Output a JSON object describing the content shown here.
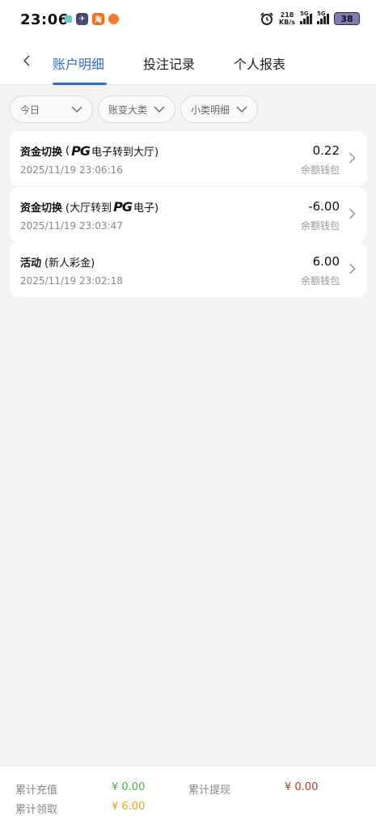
{
  "status_bar": {
    "time": "23:06",
    "net_speed_value": "218",
    "net_speed_unit": "KB/s",
    "sim1": "5G",
    "sim2": "5G",
    "battery": "38"
  },
  "nav": {
    "tabs": [
      {
        "label": "账户明细",
        "active": true
      },
      {
        "label": "投注记录",
        "active": false
      },
      {
        "label": "个人报表",
        "active": false
      }
    ]
  },
  "filters": [
    {
      "label": "今日"
    },
    {
      "label": "账变大类"
    },
    {
      "label": "小类明细"
    }
  ],
  "records": [
    {
      "type": "资金切换",
      "detail_prefix": "(",
      "logo": "PG",
      "detail_suffix": "电子转到大厅)",
      "time": "2025/11/19 23:06:16",
      "amount": "0.22",
      "wallet": "余额钱包"
    },
    {
      "type": "资金切换",
      "detail_prefix": "(大厅转到",
      "logo": "PG",
      "detail_suffix": "电子)",
      "time": "2025/11/19 23:03:47",
      "amount": "-6.00",
      "wallet": "余额钱包"
    },
    {
      "type": "活动",
      "detail_prefix": "(新人彩金)",
      "logo": "",
      "detail_suffix": "",
      "time": "2025/11/19 23:02:18",
      "amount": "6.00",
      "wallet": "余额钱包"
    }
  ],
  "footer": {
    "recharge_label": "累计充值",
    "recharge_value": "¥ 0.00",
    "withdraw_label": "累计提现",
    "withdraw_value": "¥ 0.00",
    "claim_label": "累计领取",
    "claim_value": "¥ 6.00"
  },
  "colors": {
    "accent": "#2f6bdc",
    "recharge": "#4caf50",
    "withdraw": "#c0392b",
    "claim": "#e8a317"
  }
}
